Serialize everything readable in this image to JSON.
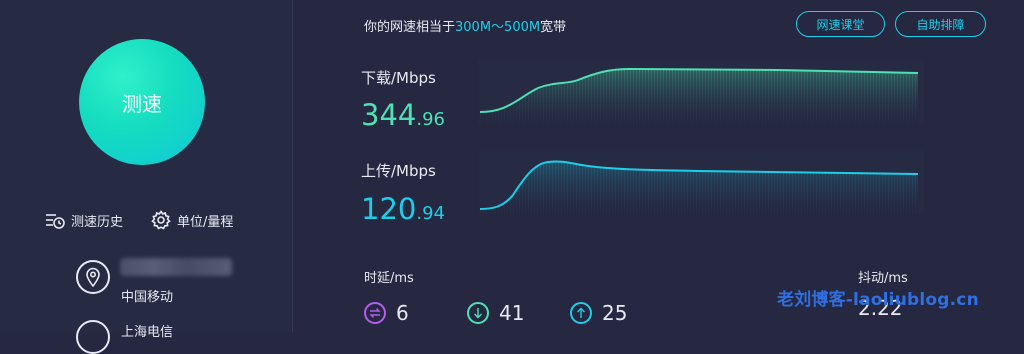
{
  "sidebar": {
    "speed_button_label": "测速",
    "history_label": "测速历史",
    "unit_label": "单位/量程",
    "isp_name": "中国移动",
    "next_item_label": "上海电信"
  },
  "header": {
    "headline_prefix": "你的网速相当于",
    "headline_highlight": "300M～500M",
    "headline_suffix": "宽带",
    "course_button": "网速课堂",
    "diagnose_button": "自助排障"
  },
  "download": {
    "label": "下载/Mbps",
    "integer": "344",
    "decimal": ".96"
  },
  "upload": {
    "label": "上传/Mbps",
    "integer": "120",
    "decimal": ".94"
  },
  "latency": {
    "label": "时延/ms",
    "items": [
      {
        "icon": "swap-icon",
        "value": "6",
        "color": "#b35cf0"
      },
      {
        "icon": "down-arrow-icon",
        "value": "41",
        "color": "#4fe0b4"
      },
      {
        "icon": "up-arrow-icon",
        "value": "25",
        "color": "#1ccfe8"
      }
    ]
  },
  "jitter": {
    "label": "抖动/ms",
    "value": "2.22"
  },
  "watermark": "老刘博客-laoliublog.cn",
  "colors": {
    "accent_cyan": "#1ccfe8",
    "accent_green": "#4fe0b4",
    "accent_purple": "#b35cf0",
    "background": "#252840"
  }
}
